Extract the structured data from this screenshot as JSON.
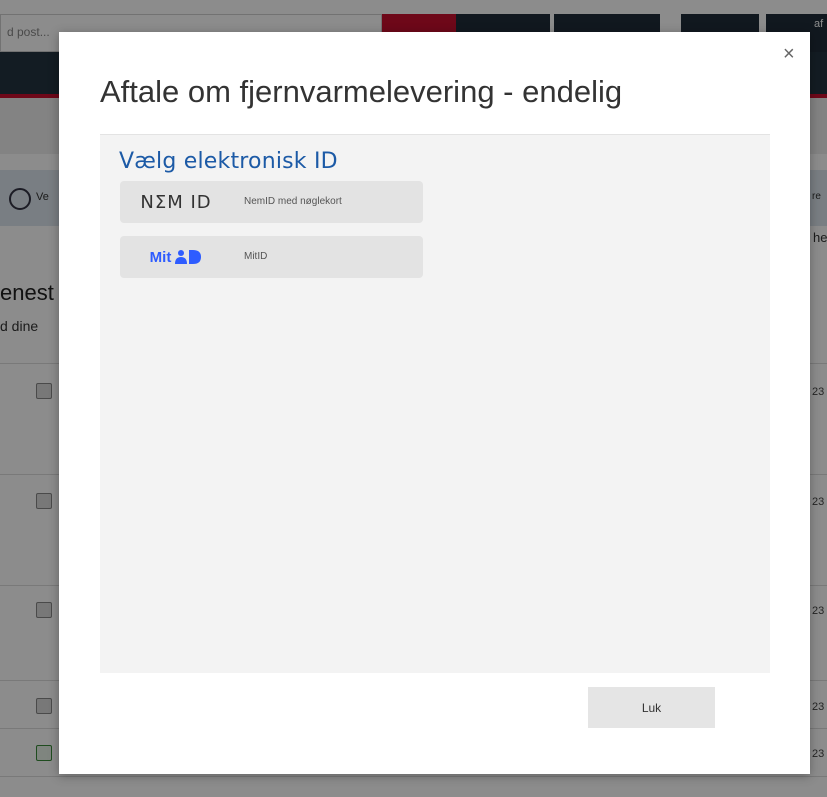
{
  "background": {
    "search_placeholder": "d post...",
    "top_right_text": "af",
    "notice_left": "Ve",
    "notice_right": "re",
    "side_right": "he",
    "heading_partial": "enest",
    "sub_partial": "d dine",
    "row_dates": [
      "23",
      "23",
      "23",
      "23",
      "23"
    ]
  },
  "modal": {
    "title": "Aftale om fjernvarmelevering - endelig",
    "close_label": "×",
    "panel_heading": "Vælg elektronisk ID",
    "options": [
      {
        "logo_text": "NΣM ID",
        "label": "NemID med nøglekort",
        "icon": "nemid-logo"
      },
      {
        "logo_text": "Mit",
        "label": "MitID",
        "icon": "mitid-logo"
      }
    ],
    "close_button": "Luk"
  },
  "colors": {
    "accent_red": "#c8102e",
    "nav_dark": "#243441",
    "heading_blue": "#1c5aa6",
    "mitid_blue": "#2e5cff"
  }
}
